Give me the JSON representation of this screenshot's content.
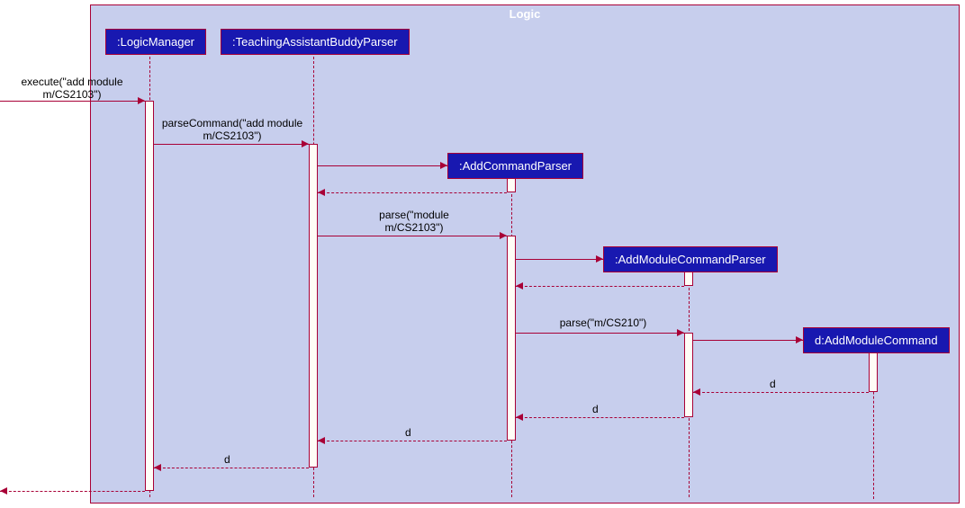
{
  "frame": {
    "title": "Logic"
  },
  "participants": {
    "p1": ":LogicManager",
    "p2": ":TeachingAssistantBuddyParser",
    "p3": ":AddCommandParser",
    "p4": ":AddModuleCommandParser",
    "p5": "d:AddModuleCommand"
  },
  "messages": {
    "m1a": "execute(\"add module",
    "m1b": "m/CS2103\")",
    "m2a": "parseCommand(\"add module",
    "m2b": "m/CS2103\")",
    "m3a": "parse(\"module",
    "m3b": "m/CS2103\")",
    "m4": "parse(\"m/CS210\")",
    "r1": "d",
    "r2": "d",
    "r3": "d",
    "r4": "d"
  }
}
